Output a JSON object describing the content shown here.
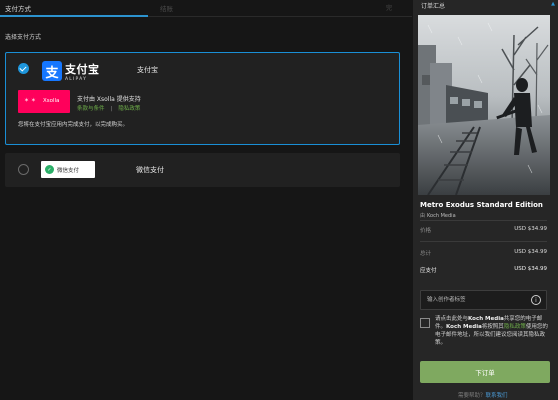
{
  "steps": {
    "tab1": "支付方式",
    "tab2": "结账",
    "tab3": "完",
    "progress_fraction": 0.36
  },
  "payment": {
    "section_title": "选择支付方式",
    "alipay": {
      "logo_cn": "支付宝",
      "logo_en": "ALIPAY",
      "name": "支付宝",
      "selected": true,
      "xsolla_label": "Xsolla",
      "provider_text": "支付由 Xsolla 提供支持",
      "terms_link": "条款与条件",
      "privacy_link": "隐私政策",
      "separator": "|",
      "notice": "您将在支付宝应用内完成支付，以完成购买。"
    },
    "wechat": {
      "logo_text": "微信支付",
      "name": "微信支付",
      "selected": false
    }
  },
  "summary": {
    "title": "订单汇总",
    "scroll_glyph": "▲",
    "game_title": "Metro Exodus Standard Edition",
    "publisher_prefix": "由",
    "publisher_name": "Koch Media",
    "price_label": "价格",
    "price_value": "USD $34.99",
    "subtotal_label": "总计",
    "subtotal_value": "USD $34.99",
    "total_label": "应支付",
    "total_value": "USD $34.99",
    "coupon_placeholder": "输入创作者标签",
    "info_glyph": "i",
    "consent_p1": "请点击此处与",
    "consent_b1": "Koch Media",
    "consent_p2": "共享您的电子邮件。",
    "consent_b2": "Koch Media",
    "consent_p3": "将按照其",
    "consent_link": "隐私政策",
    "consent_p4": "使用您的电子邮件地址，所以我们建议您阅读其隐私政策。",
    "order_button": "下订单",
    "footer_prefix": "需要帮助？",
    "footer_link": "联系我们"
  },
  "colors": {
    "accent_blue": "#1a8fd6",
    "alipay_blue": "#1677ff",
    "xsolla_pink": "#ff005b",
    "link_green": "#6fae4a",
    "order_button_green": "#7fa960",
    "wechat_green": "#2aae67"
  }
}
